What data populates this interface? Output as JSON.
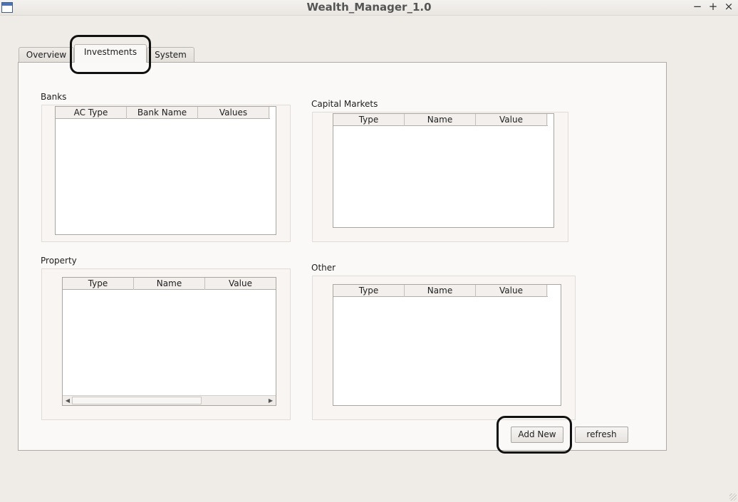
{
  "window": {
    "title": "Wealth_Manager_1.0",
    "controls": {
      "minimize": "−",
      "maximize": "+",
      "close": "×"
    }
  },
  "tabs": [
    {
      "label": "Overview",
      "active": false
    },
    {
      "label": "Investments",
      "active": true
    },
    {
      "label": "System",
      "active": false
    }
  ],
  "groups": {
    "banks": {
      "label": "Banks",
      "columns": [
        "AC Type",
        "Bank Name",
        "Values"
      ],
      "rows": []
    },
    "capital_markets": {
      "label": "Capital Markets",
      "columns": [
        "Type",
        "Name",
        "Value"
      ],
      "rows": []
    },
    "property": {
      "label": "Property",
      "columns": [
        "Type",
        "Name",
        "Value"
      ],
      "rows": []
    },
    "other": {
      "label": "Other",
      "columns": [
        "Type",
        "Name",
        "Value"
      ],
      "rows": []
    }
  },
  "buttons": {
    "add_new": "Add New",
    "refresh": "refresh"
  },
  "icons": {
    "scroll_left": "◀",
    "scroll_right": "▶"
  }
}
